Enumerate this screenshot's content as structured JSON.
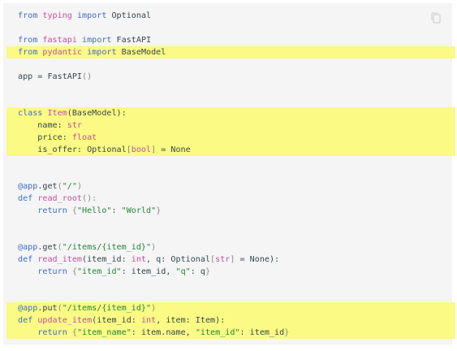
{
  "copy_button": {
    "icon": "copy-icon"
  },
  "colors": {
    "background": "#f5f5f5",
    "highlight": "#fafa84",
    "keyword": "#3f6ec6",
    "builtin": "#c74ea2",
    "string": "#22863a",
    "text": "#37474f"
  },
  "lines": [
    {
      "highlight": false,
      "tokens": [
        {
          "t": "from",
          "c": "kw"
        },
        {
          "t": " "
        },
        {
          "t": "typing",
          "c": "fn"
        },
        {
          "t": " "
        },
        {
          "t": "import",
          "c": "kw"
        },
        {
          "t": " Optional"
        }
      ]
    },
    {
      "highlight": false,
      "tokens": []
    },
    {
      "highlight": false,
      "tokens": [
        {
          "t": "from",
          "c": "kw"
        },
        {
          "t": " "
        },
        {
          "t": "fastapi",
          "c": "fn"
        },
        {
          "t": " "
        },
        {
          "t": "import",
          "c": "kw"
        },
        {
          "t": " FastAPI"
        }
      ]
    },
    {
      "highlight": true,
      "tokens": [
        {
          "t": "from",
          "c": "kw"
        },
        {
          "t": " "
        },
        {
          "t": "pydantic",
          "c": "fn"
        },
        {
          "t": " "
        },
        {
          "t": "import",
          "c": "kw"
        },
        {
          "t": " BaseModel"
        }
      ]
    },
    {
      "highlight": false,
      "tokens": []
    },
    {
      "highlight": false,
      "tokens": [
        {
          "t": "app = FastAPI"
        },
        {
          "t": "()",
          "c": "brk"
        }
      ]
    },
    {
      "highlight": false,
      "tokens": []
    },
    {
      "highlight": false,
      "tokens": []
    },
    {
      "highlight": true,
      "tokens": [
        {
          "t": "class",
          "c": "kw"
        },
        {
          "t": " "
        },
        {
          "t": "Item",
          "c": "fn"
        },
        {
          "t": "(BaseModel):"
        }
      ]
    },
    {
      "highlight": true,
      "tokens": [
        {
          "t": "    name: "
        },
        {
          "t": "str",
          "c": "fn"
        }
      ]
    },
    {
      "highlight": true,
      "tokens": [
        {
          "t": "    price: "
        },
        {
          "t": "float",
          "c": "fn"
        }
      ]
    },
    {
      "highlight": true,
      "tokens": [
        {
          "t": "    is_offer: Optional"
        },
        {
          "t": "[",
          "c": "brk"
        },
        {
          "t": "bool",
          "c": "fn"
        },
        {
          "t": "]",
          "c": "brk"
        },
        {
          "t": " = None"
        }
      ]
    },
    {
      "highlight": false,
      "tokens": []
    },
    {
      "highlight": false,
      "tokens": []
    },
    {
      "highlight": false,
      "tokens": [
        {
          "t": "@app",
          "c": "dec"
        },
        {
          "t": ".get"
        },
        {
          "t": "(",
          "c": "brk"
        },
        {
          "t": "\"/\"",
          "c": "str"
        },
        {
          "t": ")",
          "c": "brk"
        }
      ]
    },
    {
      "highlight": false,
      "tokens": [
        {
          "t": "def",
          "c": "kw"
        },
        {
          "t": " "
        },
        {
          "t": "read_root",
          "c": "fn"
        },
        {
          "t": "():",
          "c": "brk"
        }
      ]
    },
    {
      "highlight": false,
      "tokens": [
        {
          "t": "    "
        },
        {
          "t": "return",
          "c": "kw"
        },
        {
          "t": " "
        },
        {
          "t": "{",
          "c": "brk"
        },
        {
          "t": "\"Hello\"",
          "c": "str"
        },
        {
          "t": ": "
        },
        {
          "t": "\"World\"",
          "c": "str"
        },
        {
          "t": "}",
          "c": "brk"
        }
      ]
    },
    {
      "highlight": false,
      "tokens": []
    },
    {
      "highlight": false,
      "tokens": []
    },
    {
      "highlight": false,
      "tokens": [
        {
          "t": "@app",
          "c": "dec"
        },
        {
          "t": ".get"
        },
        {
          "t": "(",
          "c": "brk"
        },
        {
          "t": "\"/items/{item_id}\"",
          "c": "str"
        },
        {
          "t": ")",
          "c": "brk"
        }
      ]
    },
    {
      "highlight": false,
      "tokens": [
        {
          "t": "def",
          "c": "kw"
        },
        {
          "t": " "
        },
        {
          "t": "read_item",
          "c": "fn"
        },
        {
          "t": "(item_id: "
        },
        {
          "t": "int",
          "c": "fn"
        },
        {
          "t": ", q: Optional"
        },
        {
          "t": "[",
          "c": "brk"
        },
        {
          "t": "str",
          "c": "fn"
        },
        {
          "t": "]",
          "c": "brk"
        },
        {
          "t": " = None):"
        }
      ]
    },
    {
      "highlight": false,
      "tokens": [
        {
          "t": "    "
        },
        {
          "t": "return",
          "c": "kw"
        },
        {
          "t": " "
        },
        {
          "t": "{",
          "c": "brk"
        },
        {
          "t": "\"item_id\"",
          "c": "str"
        },
        {
          "t": ": item_id, "
        },
        {
          "t": "\"q\"",
          "c": "str"
        },
        {
          "t": ": q"
        },
        {
          "t": "}",
          "c": "brk"
        }
      ]
    },
    {
      "highlight": false,
      "tokens": []
    },
    {
      "highlight": false,
      "tokens": []
    },
    {
      "highlight": true,
      "tokens": [
        {
          "t": "@app",
          "c": "dec"
        },
        {
          "t": ".put"
        },
        {
          "t": "(",
          "c": "brk"
        },
        {
          "t": "\"/items/{item_id}\"",
          "c": "str"
        },
        {
          "t": ")",
          "c": "brk"
        }
      ]
    },
    {
      "highlight": true,
      "tokens": [
        {
          "t": "def",
          "c": "kw"
        },
        {
          "t": " "
        },
        {
          "t": "update_item",
          "c": "fn"
        },
        {
          "t": "(item_id: "
        },
        {
          "t": "int",
          "c": "fn"
        },
        {
          "t": ", item: Item):"
        }
      ]
    },
    {
      "highlight": true,
      "tokens": [
        {
          "t": "    "
        },
        {
          "t": "return",
          "c": "kw"
        },
        {
          "t": " "
        },
        {
          "t": "{",
          "c": "brk"
        },
        {
          "t": "\"item_name\"",
          "c": "str"
        },
        {
          "t": ": item.name, "
        },
        {
          "t": "\"item_id\"",
          "c": "str"
        },
        {
          "t": ": item_id"
        },
        {
          "t": "}",
          "c": "brk"
        }
      ]
    }
  ]
}
